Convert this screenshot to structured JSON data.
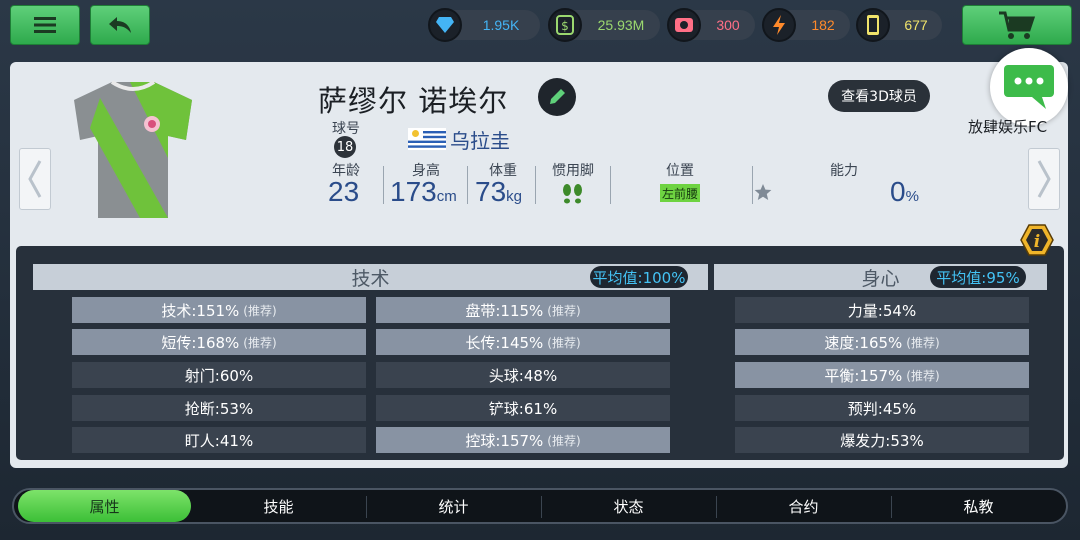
{
  "currencies": [
    {
      "icon": "diamond-icon",
      "value": "1.95K",
      "color": "#44b4f5"
    },
    {
      "icon": "cash-icon",
      "value": "25.93M",
      "color": "#9bd86f"
    },
    {
      "icon": "ticket-icon",
      "value": "300",
      "color": "#ff6f86"
    },
    {
      "icon": "energy-icon",
      "value": "182",
      "color": "#ff8a2b"
    },
    {
      "icon": "card-icon",
      "value": "677",
      "color": "#f0e36b"
    }
  ],
  "player": {
    "name": "萨缪尔 诺埃尔",
    "number_label": "球号",
    "number": "18",
    "nation": "乌拉圭",
    "age_label": "年龄",
    "age": "23",
    "height_label": "身高",
    "height": "173",
    "height_unit": "cm",
    "weight_label": "体重",
    "weight": "73",
    "weight_unit": "kg",
    "foot_label": "惯用脚",
    "position_label": "位置",
    "position": "左前腰",
    "ability_label": "能力",
    "ability": "0",
    "ability_unit": "%"
  },
  "view3d_label": "查看3D球员",
  "club_name": "放肆娱乐FC",
  "technique": {
    "title": "技术",
    "avg": "平均值:100%",
    "col1": [
      {
        "text": "技术:151%",
        "rec": "(推荐)",
        "style": "light"
      },
      {
        "text": "短传:168%",
        "rec": "(推荐)",
        "style": "light"
      },
      {
        "text": "射门:60%",
        "rec": "",
        "style": "dark"
      },
      {
        "text": "抢断:53%",
        "rec": "",
        "style": "dark"
      },
      {
        "text": "盯人:41%",
        "rec": "",
        "style": "dark"
      }
    ],
    "col2": [
      {
        "text": "盘带:115%",
        "rec": "(推荐)",
        "style": "light"
      },
      {
        "text": "长传:145%",
        "rec": "(推荐)",
        "style": "light"
      },
      {
        "text": "头球:48%",
        "rec": "",
        "style": "dark"
      },
      {
        "text": "铲球:61%",
        "rec": "",
        "style": "dark"
      },
      {
        "text": "控球:157%",
        "rec": "(推荐)",
        "style": "light"
      }
    ]
  },
  "physical": {
    "title": "身心",
    "avg": "平均值:95%",
    "col": [
      {
        "text": "力量:54%",
        "rec": "",
        "style": "dark"
      },
      {
        "text": "速度:165%",
        "rec": "(推荐)",
        "style": "light"
      },
      {
        "text": "平衡:157%",
        "rec": "(推荐)",
        "style": "light"
      },
      {
        "text": "预判:45%",
        "rec": "",
        "style": "dark"
      },
      {
        "text": "爆发力:53%",
        "rec": "",
        "style": "dark"
      }
    ]
  },
  "tabs": [
    "属性",
    "技能",
    "统计",
    "状态",
    "合约",
    "私教"
  ],
  "active_tab": 0
}
